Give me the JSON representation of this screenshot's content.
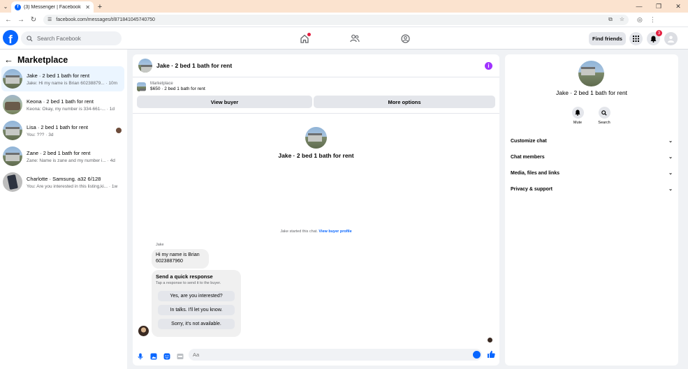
{
  "browser": {
    "tab_title": "(3) Messenger | Facebook",
    "url": "facebook.com/messages/t/871841045740750",
    "new_tab_label": "+"
  },
  "header": {
    "search_placeholder": "Search Facebook",
    "find_friends_label": "Find friends",
    "notification_count": "3"
  },
  "sidebar": {
    "title": "Marketplace",
    "conversations": [
      {
        "name": "Jake · 2 bed 1 bath for rent",
        "preview": "Jake: Hi my name is Brian 60238879... · 10m",
        "avatar": "house",
        "active": true
      },
      {
        "name": "Keona · 2 bed 1 bath for rent",
        "preview": "Keona: Okay, my number is 334-661-... · 1d",
        "avatar": "keona",
        "active": false
      },
      {
        "name": "Lisa · 2 bed 1 bath for rent",
        "preview": "You: ??? · 3d",
        "avatar": "house",
        "active": false
      },
      {
        "name": "Zane · 2 bed 1 bath for rent",
        "preview": "Zane: Name is zane and my number i... · 4d",
        "avatar": "house",
        "active": false
      },
      {
        "name": "Charlotte · Samsung. a32 6/128",
        "preview": "You: Are you interested in this listing,ki... · 1w",
        "avatar": "phone",
        "active": false
      }
    ]
  },
  "chat": {
    "title": "Jake · 2 bed 1 bath for rent",
    "marketplace_label": "Marketplace",
    "listing": "$650 · 2 bed 1 bath for rent",
    "view_buyer_label": "View buyer",
    "more_options_label": "More options",
    "center_name": "Jake · 2 bed 1 bath for rent",
    "started_text": "Jake started this chat.",
    "view_buyer_profile": "View buyer profile",
    "sender": "Jake",
    "message_line1": "Hi my name is Brian",
    "message_line2": "6023887960",
    "quick_title": "Send a quick response",
    "quick_subtitle": "Tap a response to send it to the buyer.",
    "quick_responses": [
      "Yes, are you interested?",
      "In talks. I'll let you know.",
      "Sorry, it's not available."
    ],
    "input_placeholder": "Aa"
  },
  "right_panel": {
    "name": "Jake · 2 bed 1 bath for rent",
    "mute_label": "Mute",
    "search_label": "Search",
    "sections": [
      "Customize chat",
      "Chat members",
      "Media, files and links",
      "Privacy & support"
    ]
  },
  "colors": {
    "brand": "#0866ff",
    "info": "#a033ff",
    "badge": "#e41e3f",
    "active_bg": "#ebf5ff"
  }
}
